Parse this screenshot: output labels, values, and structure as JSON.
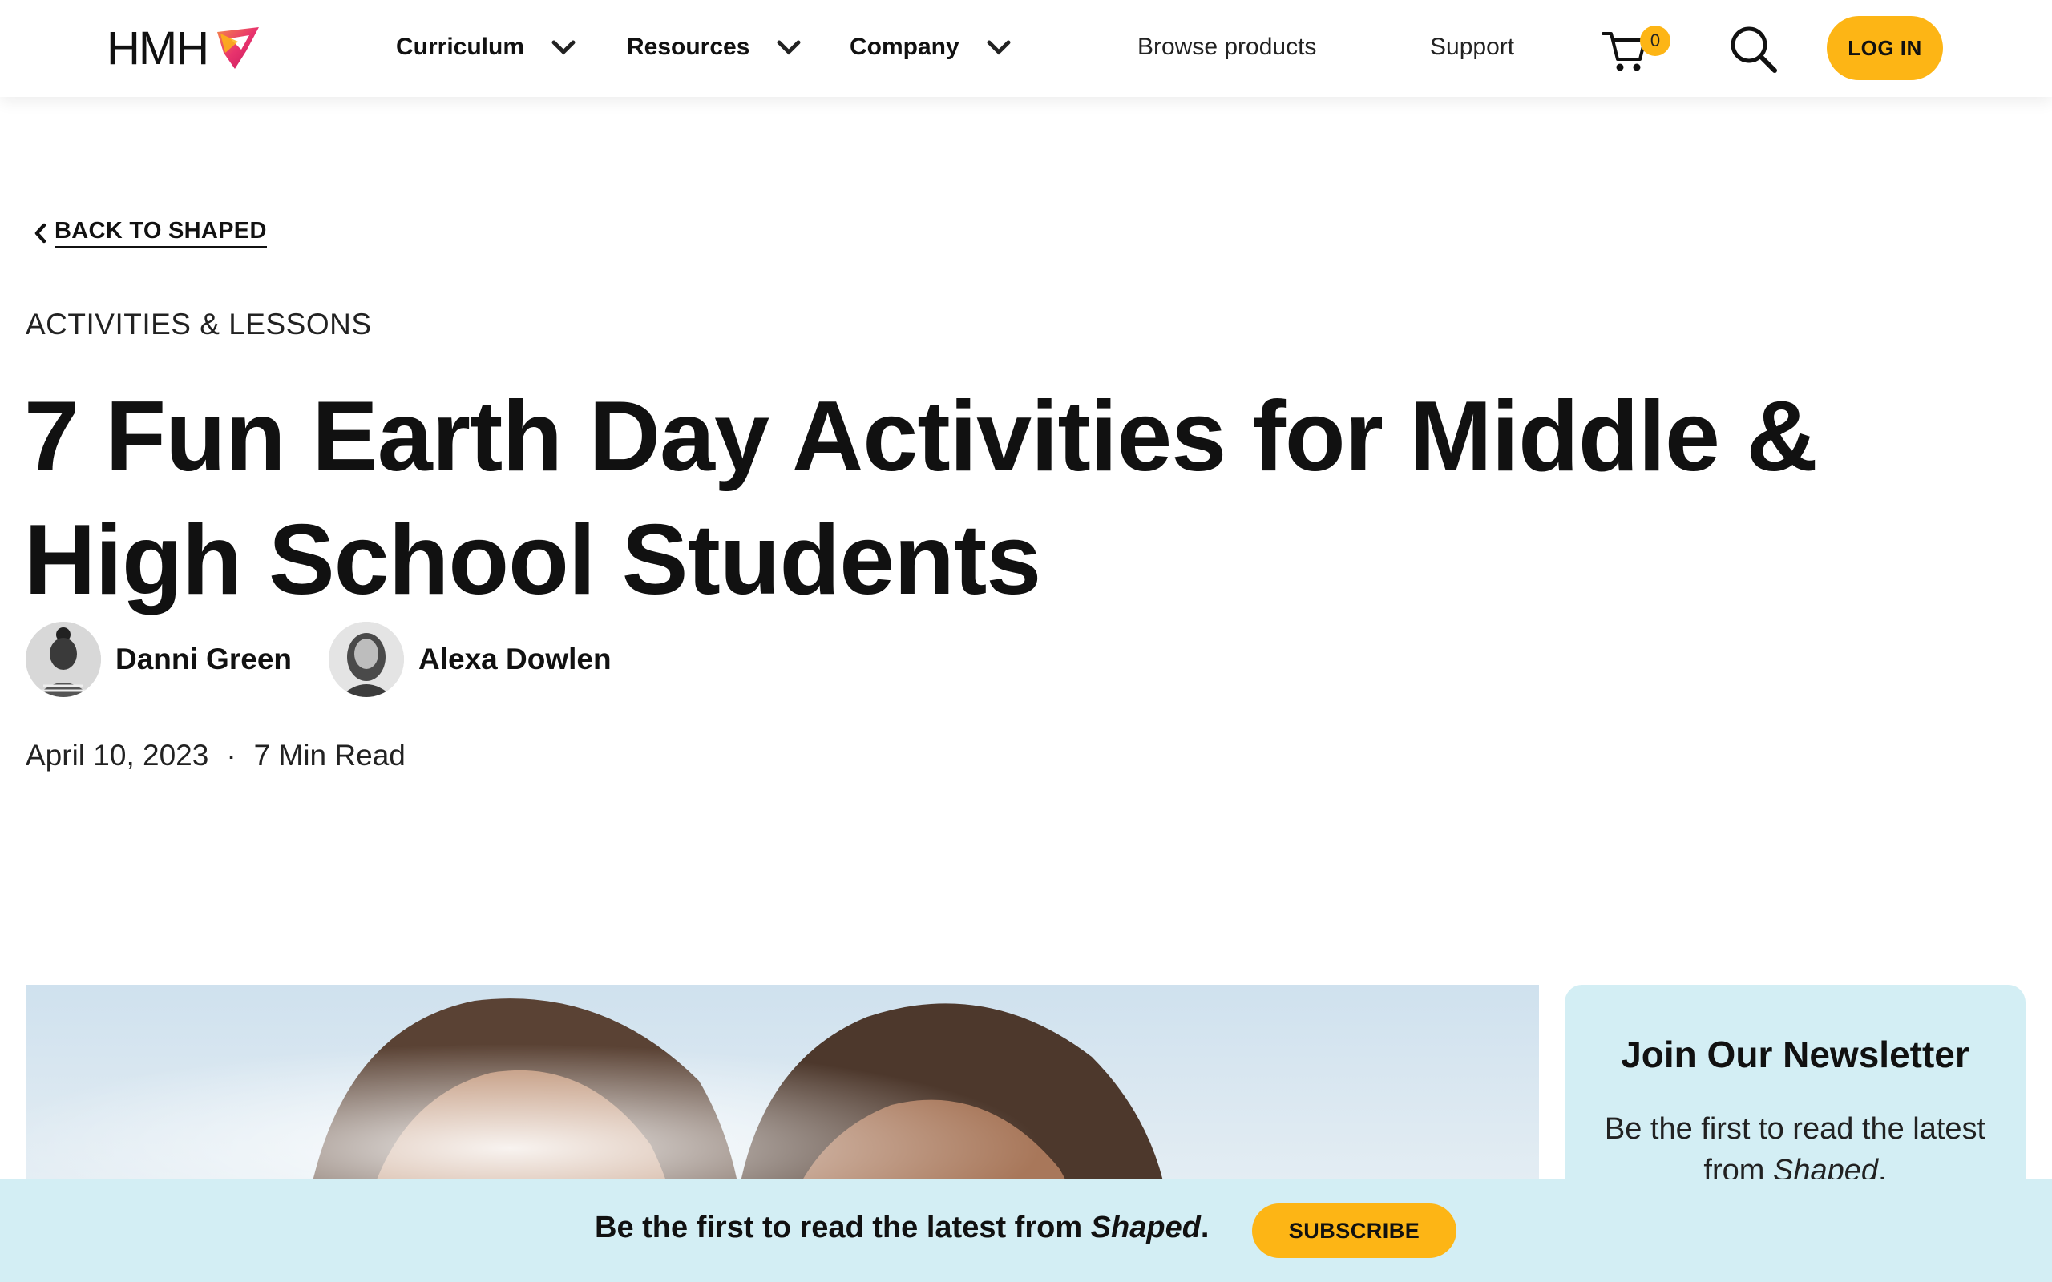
{
  "brand": {
    "logo_text": "HMH",
    "accent_color": "#fdb515",
    "logo_mark_colors": [
      "#e8336d",
      "#f5874a",
      "#fdb515"
    ]
  },
  "nav": {
    "dropdowns": [
      {
        "label": "Curriculum",
        "icon": "chevron-down-icon"
      },
      {
        "label": "Resources",
        "icon": "chevron-down-icon"
      },
      {
        "label": "Company",
        "icon": "chevron-down-icon"
      }
    ],
    "links": [
      "Browse products",
      "Support"
    ],
    "cart_count": "0",
    "cart_icon": "cart-icon",
    "search_icon": "search-icon",
    "login_label": "LOG IN"
  },
  "article": {
    "back_label": "BACK TO SHAPED",
    "category": "ACTIVITIES & LESSONS",
    "title": "7 Fun Earth Day Activities for Middle & High School Students",
    "authors": [
      {
        "name": "Danni Green"
      },
      {
        "name": "Alexa Dowlen"
      }
    ],
    "date": "April 10, 2023",
    "separator": "·",
    "read_time": "7 Min Read"
  },
  "newsletter": {
    "title": "Join Our Newsletter",
    "body_prefix": "Be the first to read the latest from ",
    "body_brand": "Shaped",
    "body_suffix": "."
  },
  "subscribe_bar": {
    "text_prefix": "Be the first to read the latest from ",
    "text_brand": "Shaped",
    "text_suffix": ".",
    "button_label": "SUBSCRIBE",
    "background": "#d3eef4"
  }
}
